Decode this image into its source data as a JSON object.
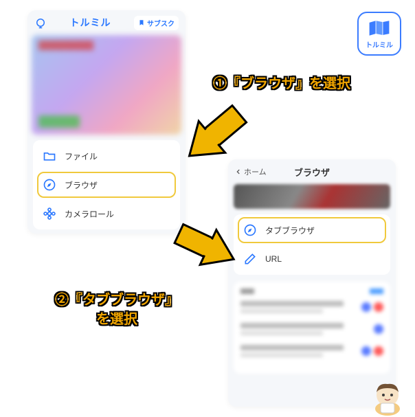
{
  "logo_text": "トルミル",
  "panel1": {
    "header_title": "トルミル",
    "subscribe_label": "サブスク",
    "menu": {
      "file_label": "ファイル",
      "browser_label": "ブラウザ",
      "camera_label": "カメラロール"
    }
  },
  "panel2": {
    "back_label": "ホーム",
    "title": "ブラウザ",
    "menu": {
      "tabbrowser_label": "タブブラウザ",
      "url_label": "URL"
    }
  },
  "callouts": {
    "step1": "①『ブラウザ』を選択",
    "step2": "②『タブブラウザ』\nを選択"
  },
  "colors": {
    "accent": "#2b78ff",
    "highlight": "#f0c93c",
    "callout": "#f0a500"
  }
}
